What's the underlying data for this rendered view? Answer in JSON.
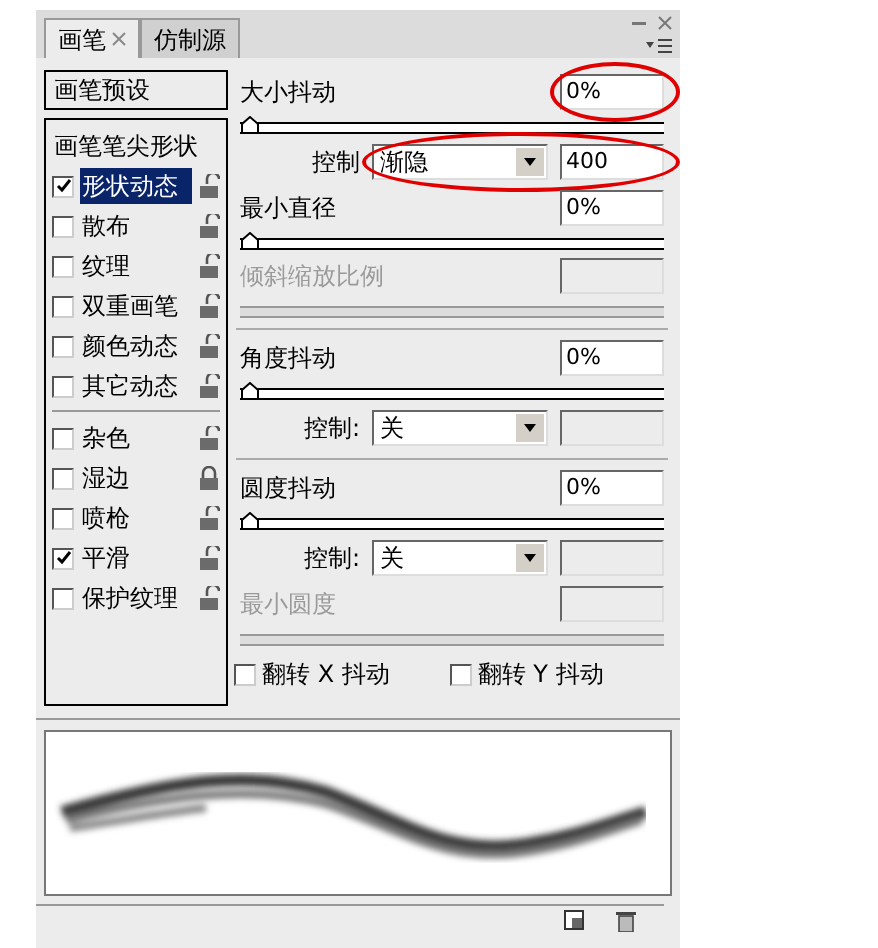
{
  "tabs": [
    {
      "label": "画笔",
      "selected": true
    },
    {
      "label": "仿制源",
      "selected": false
    }
  ],
  "presets_button": "画笔预设",
  "option_groups": [
    [
      {
        "label": "画笔笔尖形状",
        "kind": "heading"
      },
      {
        "label": "形状动态",
        "kind": "check",
        "checked": true,
        "selected": true,
        "locked": false
      },
      {
        "label": "散布",
        "kind": "check",
        "checked": false,
        "selected": false,
        "locked": false
      },
      {
        "label": "纹理",
        "kind": "check",
        "checked": false,
        "selected": false,
        "locked": false
      },
      {
        "label": "双重画笔",
        "kind": "check",
        "checked": false,
        "selected": false,
        "locked": false
      },
      {
        "label": "颜色动态",
        "kind": "check",
        "checked": false,
        "selected": false,
        "locked": false
      },
      {
        "label": "其它动态",
        "kind": "check",
        "checked": false,
        "selected": false,
        "locked": false
      }
    ],
    [
      {
        "label": "杂色",
        "kind": "check",
        "checked": false,
        "selected": false,
        "locked": false
      },
      {
        "label": "湿边",
        "kind": "check",
        "checked": false,
        "selected": false,
        "locked": true
      },
      {
        "label": "喷枪",
        "kind": "check",
        "checked": false,
        "selected": false,
        "locked": false
      },
      {
        "label": "平滑",
        "kind": "check",
        "checked": true,
        "selected": false,
        "locked": false
      },
      {
        "label": "保护纹理",
        "kind": "check",
        "checked": false,
        "selected": false,
        "locked": false
      }
    ]
  ],
  "settings": [
    {
      "kind": "value",
      "label": "大小抖动",
      "value": "0%",
      "disabled": false,
      "circled": true
    },
    {
      "kind": "slider",
      "level": 0,
      "disabled": false
    },
    {
      "kind": "control",
      "label": "控制",
      "value": "渐隐",
      "amount": "400",
      "circled": true
    },
    {
      "kind": "value",
      "label": "最小直径",
      "value": "0%",
      "disabled": false
    },
    {
      "kind": "slider",
      "level": 0,
      "disabled": false
    },
    {
      "kind": "value",
      "label": "倾斜缩放比例",
      "disabled": true
    },
    {
      "kind": "slider",
      "disabled": true
    },
    {
      "kind": "divider"
    },
    {
      "kind": "value",
      "label": "角度抖动",
      "value": "0%",
      "disabled": false
    },
    {
      "kind": "slider",
      "level": 0,
      "disabled": false
    },
    {
      "kind": "control",
      "label": "控制:",
      "value": "关"
    },
    {
      "kind": "divider"
    },
    {
      "kind": "value",
      "label": "圆度抖动",
      "value": "0%",
      "disabled": false
    },
    {
      "kind": "slider",
      "level": 0,
      "disabled": false
    },
    {
      "kind": "control",
      "label": "控制:",
      "value": "关"
    },
    {
      "kind": "value",
      "label": "最小圆度",
      "disabled": true
    },
    {
      "kind": "slider",
      "disabled": true
    }
  ],
  "flips": [
    {
      "label": "翻转 X 抖动",
      "checked": false
    },
    {
      "label": "翻转 Y 抖动",
      "checked": false
    }
  ]
}
